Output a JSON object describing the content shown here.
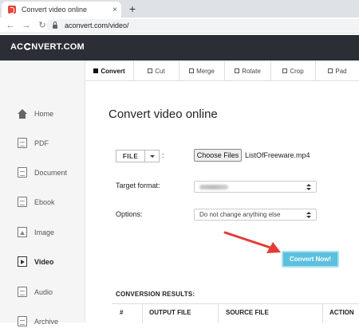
{
  "browser": {
    "tab_title": "Convert video online",
    "tab_close": "×",
    "new_tab": "+",
    "back": "←",
    "forward": "→",
    "reload": "↻",
    "url": "aconvert.com/video/"
  },
  "site": {
    "logo_left": "AC",
    "logo_right": "NVERT.COM"
  },
  "sidebar": {
    "items": [
      {
        "label": "Home",
        "icon": "home-icon"
      },
      {
        "label": "PDF",
        "icon": "pdf-icon"
      },
      {
        "label": "Document",
        "icon": "document-icon"
      },
      {
        "label": "Ebook",
        "icon": "ebook-icon"
      },
      {
        "label": "Image",
        "icon": "image-icon"
      },
      {
        "label": "Video",
        "icon": "video-icon",
        "active": true
      },
      {
        "label": "Audio",
        "icon": "audio-icon"
      },
      {
        "label": "Archive",
        "icon": "archive-icon"
      }
    ]
  },
  "tools": {
    "tabs": [
      {
        "label": "Convert",
        "active": true
      },
      {
        "label": "Cut"
      },
      {
        "label": "Merge"
      },
      {
        "label": "Rotate"
      },
      {
        "label": "Crop"
      },
      {
        "label": "Pad"
      }
    ]
  },
  "main": {
    "title": "Convert video online",
    "file_button": "FILE",
    "colon": ":",
    "choose_files": "Choose Files",
    "chosen_file": "ListOfFreeware.mp4",
    "target_format_label": "Target format:",
    "options_label": "Options:",
    "options_value": "Do not change anything else",
    "convert_button": "Convert Now!",
    "results_title": "CONVERSION RESULTS:",
    "columns": [
      "#",
      "OUTPUT FILE",
      "SOURCE FILE",
      "ACTION"
    ]
  },
  "colors": {
    "header_bg": "#2b2f35",
    "convert_btn": "#5bc0de",
    "arrow": "#e53935"
  }
}
